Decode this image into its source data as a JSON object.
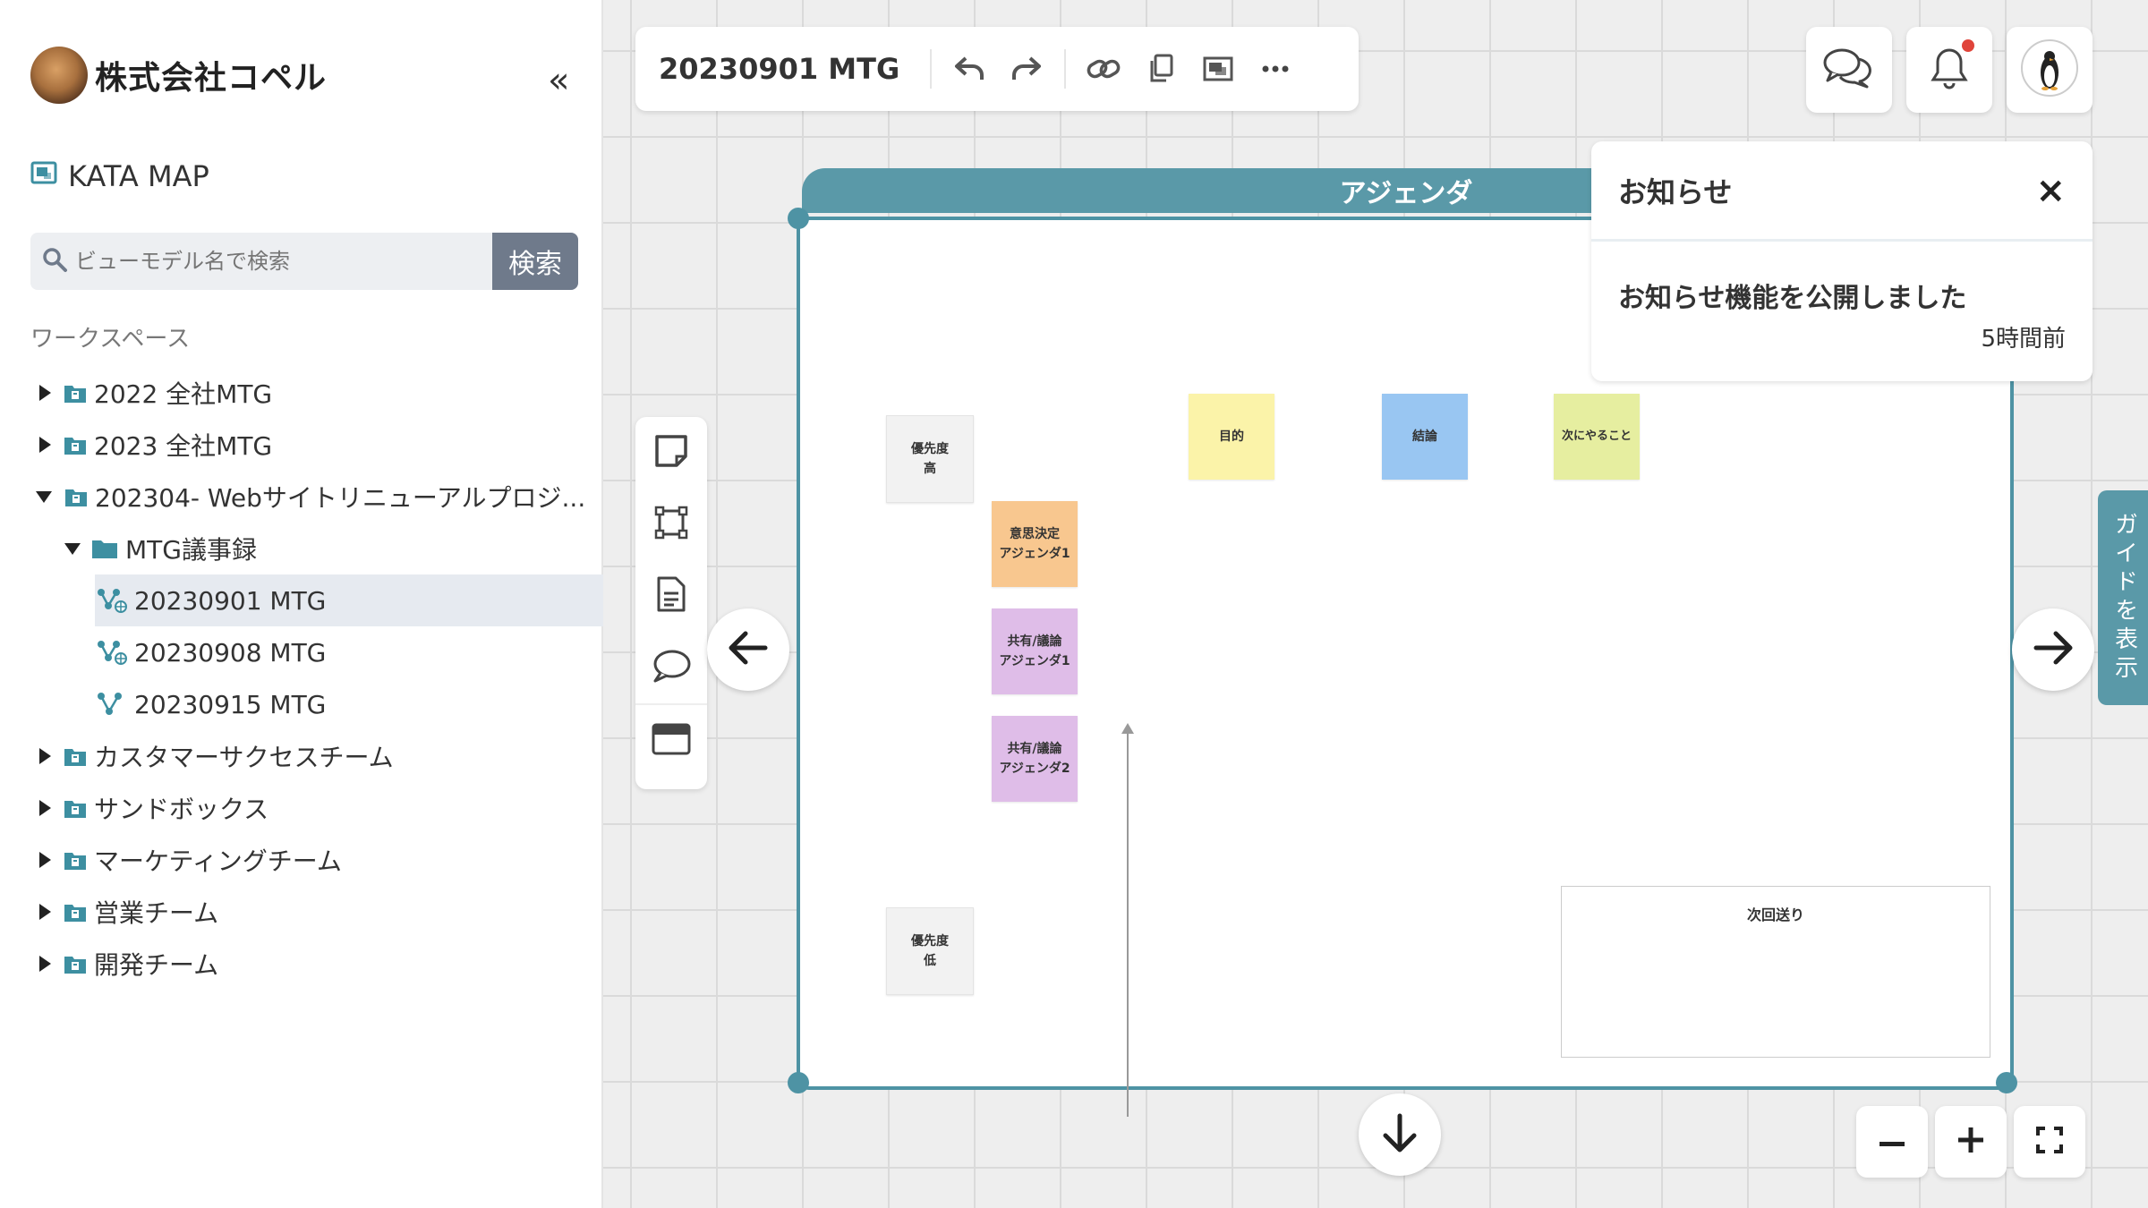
{
  "sidebar": {
    "company": "株式会社コペル",
    "collapse_icon": "«",
    "app_name": "KATA MAP",
    "search": {
      "placeholder": "ビューモデル名で検索",
      "button": "検索"
    },
    "workspace_label": "ワークスペース",
    "tree": [
      {
        "label": "2022 全社MTG",
        "type": "workspace",
        "expanded": false
      },
      {
        "label": "2023 全社MTG",
        "type": "workspace",
        "expanded": false
      },
      {
        "label": "202304- Webサイトリニューアルプロジ...",
        "type": "workspace",
        "expanded": true
      },
      {
        "label": "MTG議事録",
        "type": "folder",
        "expanded": true
      },
      {
        "label": "20230901 MTG",
        "type": "map",
        "selected": true
      },
      {
        "label": "20230908 MTG",
        "type": "map"
      },
      {
        "label": "20230915 MTG",
        "type": "map"
      },
      {
        "label": "カスタマーサクセスチーム",
        "type": "workspace",
        "expanded": false
      },
      {
        "label": "サンドボックス",
        "type": "workspace",
        "expanded": false
      },
      {
        "label": "マーケティングチーム",
        "type": "workspace",
        "expanded": false
      },
      {
        "label": "営業チーム",
        "type": "workspace",
        "expanded": false
      },
      {
        "label": "開発チーム",
        "type": "workspace",
        "expanded": false
      }
    ]
  },
  "toolbar": {
    "title": "20230901 MTG",
    "icons": [
      "undo-icon",
      "redo-icon",
      "link-icon",
      "copy-icon",
      "image-icon",
      "more-icon"
    ]
  },
  "frame": {
    "title": "アジェンダ",
    "axis_high": "優先度\n高",
    "axis_low": "優先度\n低",
    "stickies": [
      {
        "text": "目的",
        "color": "#fbf3a9"
      },
      {
        "text": "結論",
        "color": "#99c6f2"
      },
      {
        "text": "次にやること",
        "color": "#e6eea0"
      },
      {
        "text": "意思決定\nアジェンダ1",
        "color": "#f8c78f"
      },
      {
        "text": "共有/議論\nアジェンダ1",
        "color": "#dfbde8"
      },
      {
        "text": "共有/議論\nアジェンダ2",
        "color": "#dfbde8"
      }
    ],
    "next_box": "次回送り"
  },
  "notification": {
    "title": "お知らせ",
    "close": "×",
    "message": "お知らせ機能を公開しました",
    "time": "5時間前"
  },
  "guide_tab": "ガイドを表示",
  "zoom": {
    "minus": "−",
    "plus": "+"
  },
  "colors": {
    "accent": "#4e93a4",
    "badge": "#e0443a",
    "sidebar_selected": "#e6eaf0"
  }
}
